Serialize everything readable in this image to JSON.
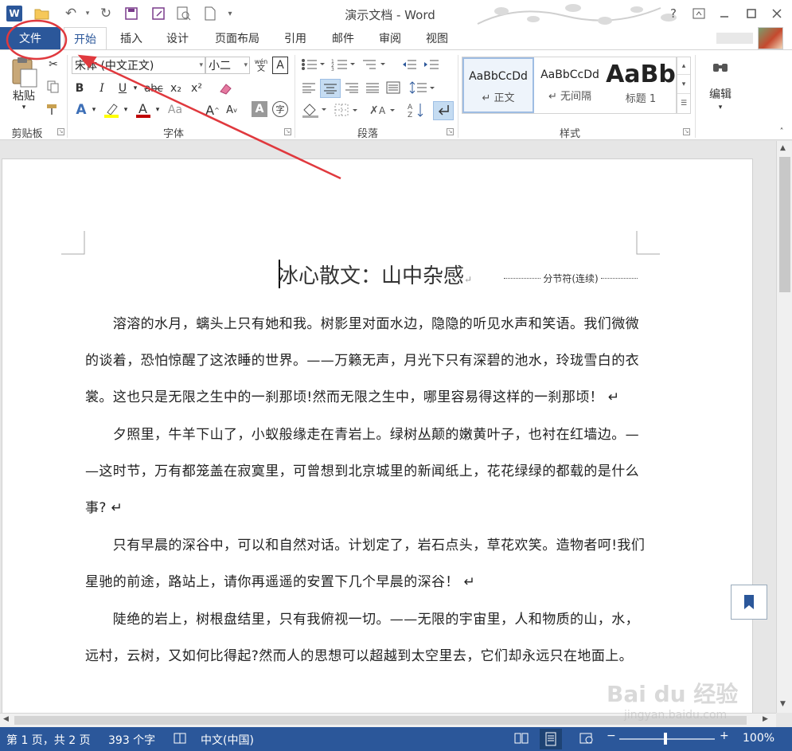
{
  "titlebar": {
    "title": "演示文档 - Word",
    "help": "?",
    "word_logo": "W"
  },
  "tabs": {
    "file": "文件",
    "items": [
      "开始",
      "插入",
      "设计",
      "页面布局",
      "引用",
      "邮件",
      "审阅",
      "视图"
    ]
  },
  "ribbon": {
    "clipboard": {
      "paste_label": "粘贴",
      "group_label": "剪贴板"
    },
    "font": {
      "font_name": "宋体 (中文正文)",
      "font_size": "小二",
      "group_label": "字体",
      "bold": "B",
      "italic": "I",
      "underline": "U",
      "strike": "abc",
      "sub": "x₂",
      "sup": "x²",
      "aa": "Aa"
    },
    "paragraph": {
      "group_label": "段落"
    },
    "styles": {
      "group_label": "样式",
      "items": [
        {
          "preview": "AaBbCcDd",
          "name": "↵ 正文"
        },
        {
          "preview": "AaBbCcDd",
          "name": "↵ 无间隔"
        },
        {
          "preview": "AaBb",
          "name": "标题 1"
        }
      ]
    },
    "edit": {
      "label": "编辑"
    }
  },
  "document": {
    "title": "冰心散文：山中杂感",
    "section_break": "分节符(连续)",
    "lines": [
      "　　溶溶的水月，螭头上只有她和我。树影里对面水边，隐隐的听见水声和笑语。我们微微",
      "的谈着，恐怕惊醒了这浓睡的世界。——万籁无声，月光下只有深碧的池水，玲珑雪白的衣",
      "裳。这也只是无限之生中的一刹那顷!然而无限之生中，哪里容易得这样的一刹那顷！ ↵",
      "　　夕照里，牛羊下山了，小蚁般缘走在青岩上。绿树丛颠的嫩黄叶子，也衬在红墙边。—",
      "—这时节，万有都笼盖在寂寞里，可曾想到北京城里的新闻纸上，花花绿绿的都载的是什么",
      "事? ↵",
      "　　只有早晨的深谷中，可以和自然对话。计划定了，岩石点头，草花欢笑。造物者呵!我们",
      "星驰的前途，路站上，请你再遥遥的安置下几个早晨的深谷！ ↵",
      "　　陡绝的岩上，树根盘结里，只有我俯视一切。——无限的宇宙里，人和物质的山，水，",
      "远村，云树，又如何比得起?然而人的思想可以超越到太空里去，它们却永远只在地面上。"
    ]
  },
  "status": {
    "page": "第 1 页，共 2 页",
    "words": "393 个字",
    "language": "中文(中国)",
    "zoom": "100%",
    "zoom_minus": "−",
    "zoom_plus": "+"
  },
  "watermark": {
    "brand": "Bai du 经验",
    "url": "jingyan.baidu.com"
  },
  "colors": {
    "accent": "#2b579a",
    "annotation": "#e0393e",
    "highlight": "#ffff00",
    "font_color": "#c00000"
  },
  "icons": [
    "word-logo-icon",
    "undo-icon",
    "redo-icon",
    "save-icon",
    "print-preview-icon",
    "new-doc-icon",
    "help-icon",
    "restore-icon",
    "minimize-icon",
    "close-icon",
    "paste-icon",
    "cut-icon",
    "copy-icon",
    "format-painter-icon",
    "find-icon",
    "bookmark-icon"
  ]
}
